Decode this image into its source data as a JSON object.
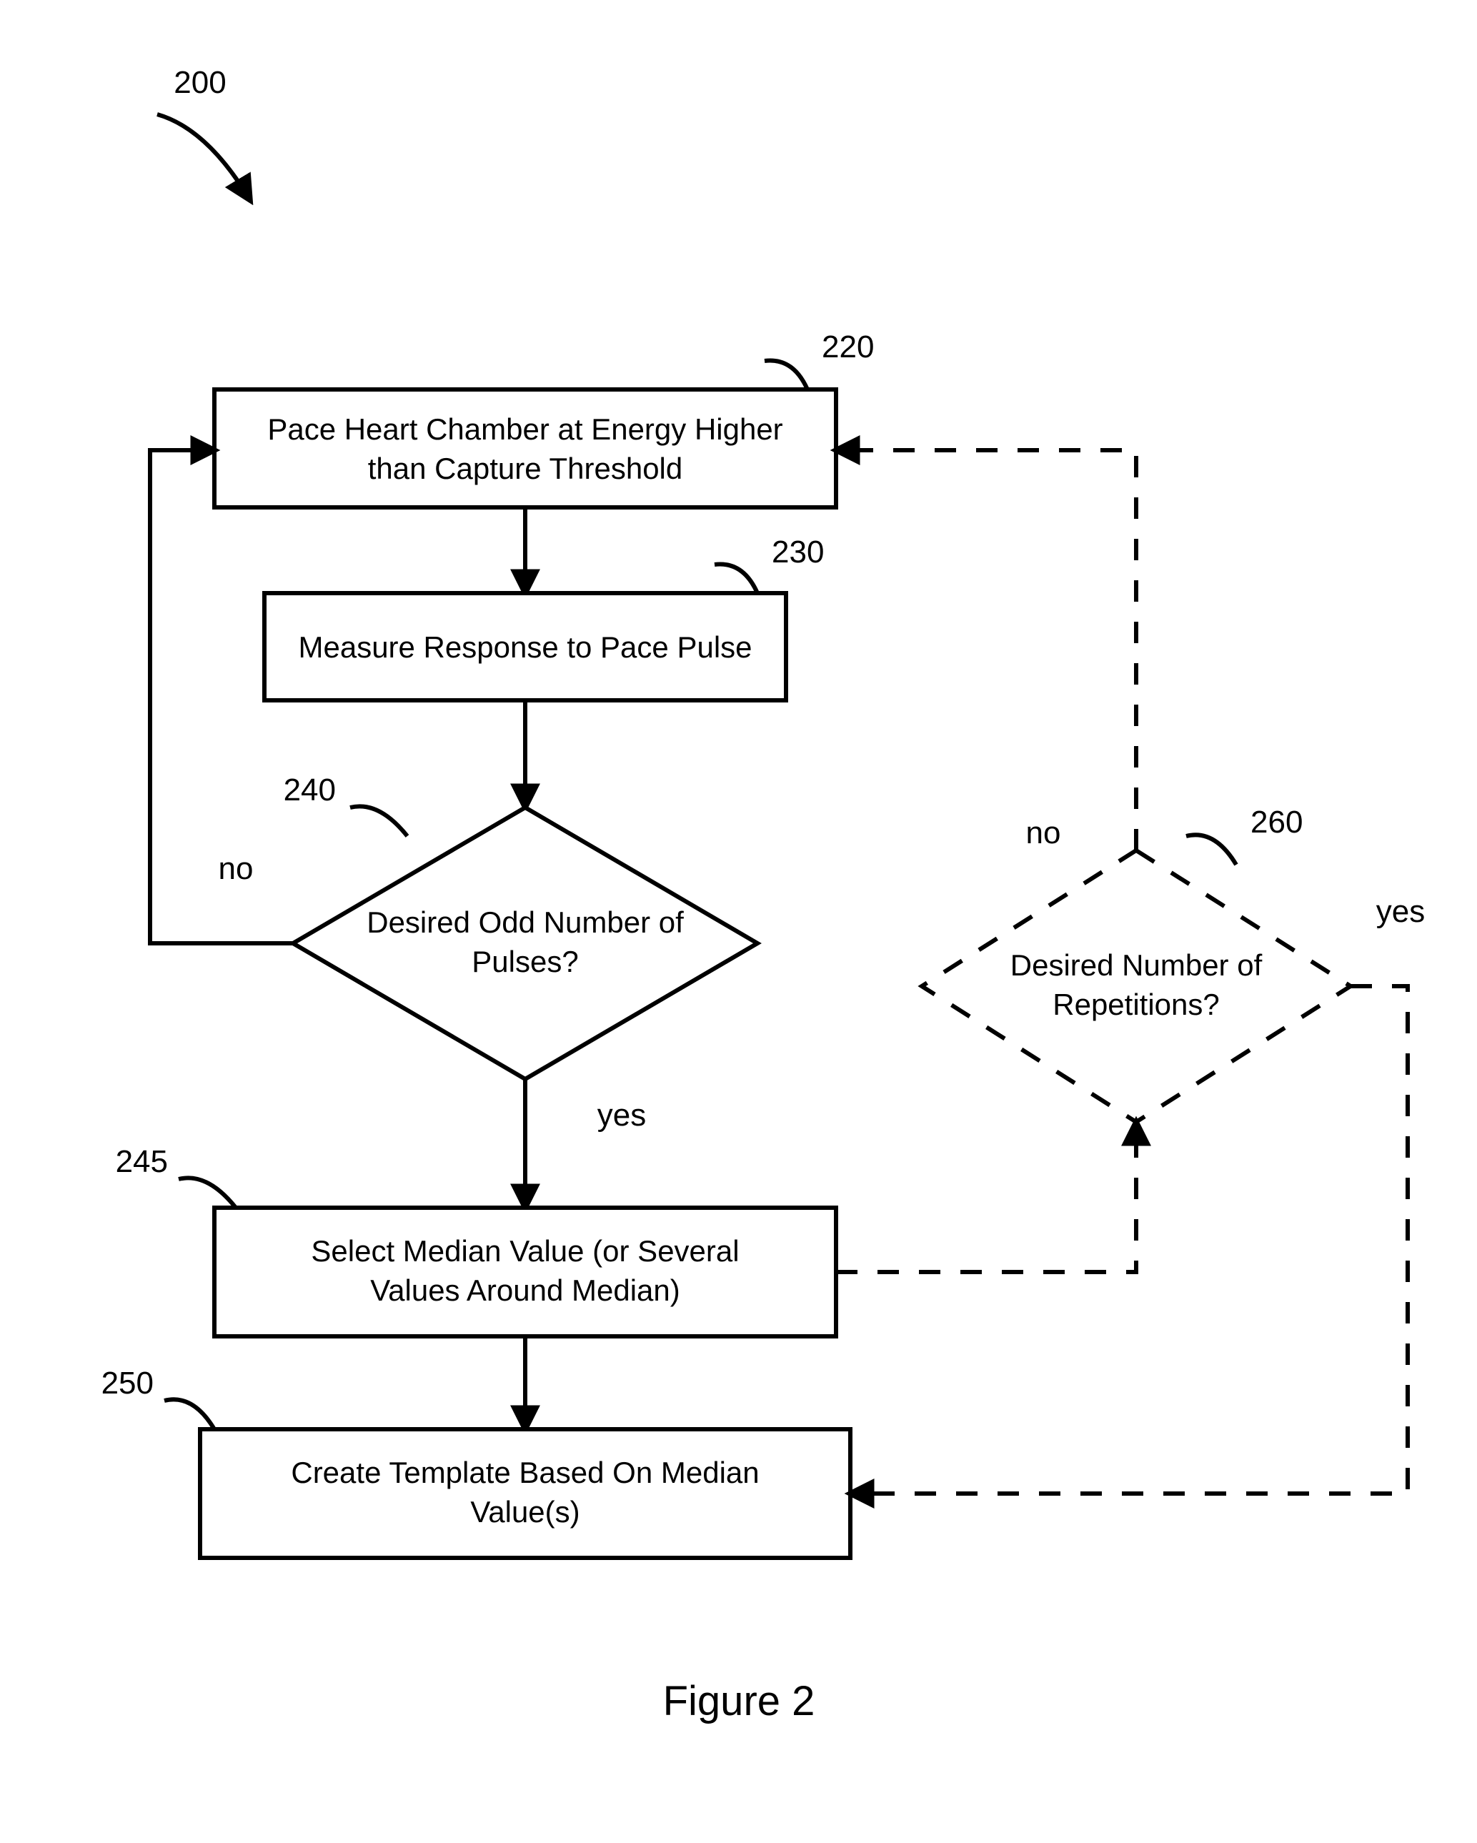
{
  "figure_ref": "200",
  "figure_caption": "Figure 2",
  "nodes": {
    "n220": {
      "ref": "220",
      "line1": "Pace Heart Chamber at Energy Higher",
      "line2": "than Capture Threshold"
    },
    "n230": {
      "ref": "230",
      "text": "Measure Response to Pace Pulse"
    },
    "n240": {
      "ref": "240",
      "line1": "Desired Odd Number of",
      "line2": "Pulses?"
    },
    "n245": {
      "ref": "245",
      "line1": "Select Median Value (or Several",
      "line2": "Values Around Median)"
    },
    "n250": {
      "ref": "250",
      "line1": "Create Template Based On Median",
      "line2": "Value(s)"
    },
    "n260": {
      "ref": "260",
      "line1": "Desired Number of",
      "line2": "Repetitions?"
    }
  },
  "edge_labels": {
    "e240_no": "no",
    "e240_yes": "yes",
    "e260_no": "no",
    "e260_yes": "yes"
  }
}
